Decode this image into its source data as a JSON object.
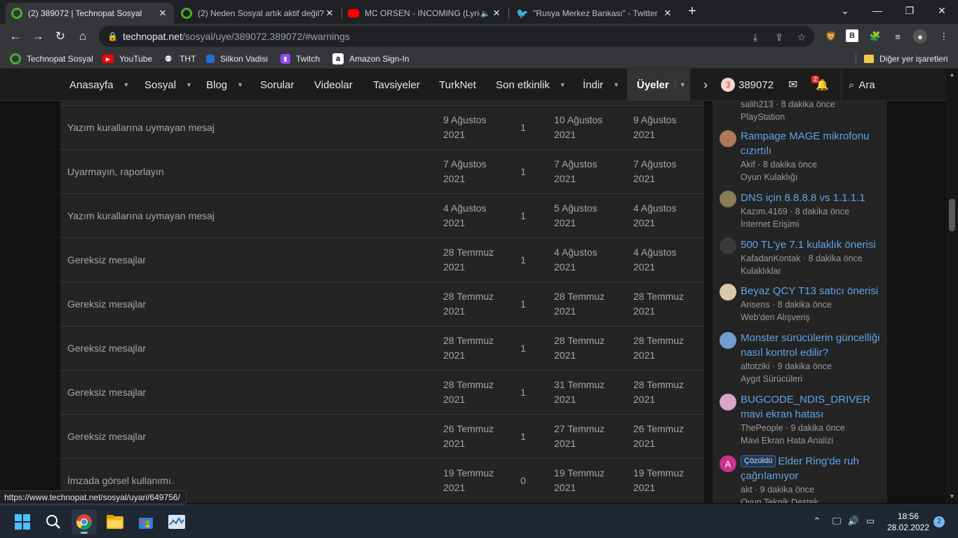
{
  "browser": {
    "tabs": [
      {
        "title": "(2) 389072 | Technopat Sosyal",
        "active": true
      },
      {
        "title": "(2) Neden Sosyal artık aktif değil?",
        "active": false
      },
      {
        "title": "MC ORSEN - INCOMING (Lyrics)",
        "active": false
      },
      {
        "title": "\"Rusya Merkez Bankası\" - Twitter",
        "active": false
      }
    ],
    "url": {
      "host": "technopat.net",
      "path": "/sosyal/uye/389072.389072/#warnings"
    },
    "bookmarks": [
      "Technopat Sosyal",
      "YouTube",
      "THT",
      "Silkon Vadisi",
      "Twitch",
      "Amazon Sign-In"
    ],
    "other_bookmarks": "Diğer yer işaretleri",
    "profile_initial": "B"
  },
  "site_nav": {
    "items": [
      "Anasayfa",
      "Sosyal",
      "Blog",
      "Sorular",
      "Videolar",
      "Tavsiyeler",
      "TurkNet",
      "Son etkinlik",
      "İndir",
      "Üyeler"
    ],
    "user_count": "3",
    "username": "389072",
    "alerts_count": "2",
    "search_label": "Ara"
  },
  "warnings": [
    {
      "reason": "Yazım kurallarına uymayan mesaj",
      "date": [
        "9 Ağustos",
        "2021"
      ],
      "points": "1",
      "expiry": [
        "10 Ağustos",
        "2021"
      ],
      "last": [
        "9 Ağustos",
        "2021"
      ]
    },
    {
      "reason": "Uyarmayın, raporlayın",
      "date": [
        "7 Ağustos",
        "2021"
      ],
      "points": "1",
      "expiry": [
        "7 Ağustos",
        "2021"
      ],
      "last": [
        "7 Ağustos",
        "2021"
      ]
    },
    {
      "reason": "Yazım kurallarına uymayan mesaj",
      "date": [
        "4 Ağustos",
        "2021"
      ],
      "points": "1",
      "expiry": [
        "5 Ağustos",
        "2021"
      ],
      "last": [
        "4 Ağustos",
        "2021"
      ]
    },
    {
      "reason": "Gereksiz mesajlar",
      "date": [
        "28 Temmuz",
        "2021"
      ],
      "points": "1",
      "expiry": [
        "4 Ağustos",
        "2021"
      ],
      "last": [
        "4 Ağustos",
        "2021"
      ]
    },
    {
      "reason": "Gereksiz mesajlar",
      "date": [
        "28 Temmuz",
        "2021"
      ],
      "points": "1",
      "expiry": [
        "28 Temmuz",
        "2021"
      ],
      "last": [
        "28 Temmuz",
        "2021"
      ]
    },
    {
      "reason": "Gereksiz mesajlar",
      "date": [
        "28 Temmuz",
        "2021"
      ],
      "points": "1",
      "expiry": [
        "28 Temmuz",
        "2021"
      ],
      "last": [
        "28 Temmuz",
        "2021"
      ]
    },
    {
      "reason": "Gereksiz mesajlar",
      "date": [
        "28 Temmuz",
        "2021"
      ],
      "points": "1",
      "expiry": [
        "31 Temmuz",
        "2021"
      ],
      "last": [
        "28 Temmuz",
        "2021"
      ]
    },
    {
      "reason": "Gereksiz mesajlar",
      "date": [
        "26 Temmuz",
        "2021"
      ],
      "points": "1",
      "expiry": [
        "27 Temmuz",
        "2021"
      ],
      "last": [
        "26 Temmuz",
        "2021"
      ]
    },
    {
      "reason": "İmzada görsel kullanımı.",
      "date": [
        "19 Temmuz",
        "2021"
      ],
      "points": "0",
      "expiry": [
        "19 Temmuz",
        "2021"
      ],
      "last": [
        "19 Temmuz",
        "2021"
      ]
    }
  ],
  "sidebar": {
    "top_meta": "salih213 · 8 dakika önce",
    "top_forum": "PlayStation",
    "threads": [
      {
        "title": "Rampage MAGE mikrofonu cızırtılı",
        "meta": "Akif · 8 dakika önce",
        "forum": "Oyun Kulaklığı",
        "avatar_color": "#b07a5a"
      },
      {
        "title": "DNS için 8.8.8.8 vs 1.1.1.1",
        "meta": "Kazım.4169 · 8 dakika önce",
        "forum": "İnternet Erişimi",
        "avatar_color": "#8a7a55"
      },
      {
        "title": "500 TL'ye 7.1 kulaklık önerisi",
        "meta": "KafadanKontak · 8 dakika önce",
        "forum": "Kulaklıklar",
        "avatar_color": "#3a3a3a"
      },
      {
        "title": "Beyaz QCY T13 satıcı önerisi",
        "meta": "Arisens · 8 dakika önce",
        "forum": "Web'den Alışveriş",
        "avatar_color": "#d9c9a8"
      },
      {
        "title": "Monster sürücülerin güncelliği nasıl kontrol edilir?",
        "meta": "altotziki · 9 dakika önce",
        "forum": "Aygıt Sürücüleri",
        "avatar_color": "#6fa0d0"
      },
      {
        "title": "BUGCODE_NDIS_DRIVER mavi ekran hatası",
        "meta": "ThePeople · 9 dakika önce",
        "forum": "Mavi Ekran Hata Analizi",
        "avatar_color": "#d7a6c7"
      },
      {
        "title": "Elder Ring'de ruh çağrılamıyor",
        "meta": "akt · 9 dakika önce",
        "forum": "Oyun Teknik Destek",
        "avatar_color": "#c9338d",
        "avatar_letter": "A",
        "prefix": "Çözüldü"
      }
    ]
  },
  "status_url": "https://www.technopat.net/sosyal/uyari/649756/",
  "taskbar": {
    "time": "18:56",
    "date": "28.02.2022",
    "notifications": "2"
  }
}
